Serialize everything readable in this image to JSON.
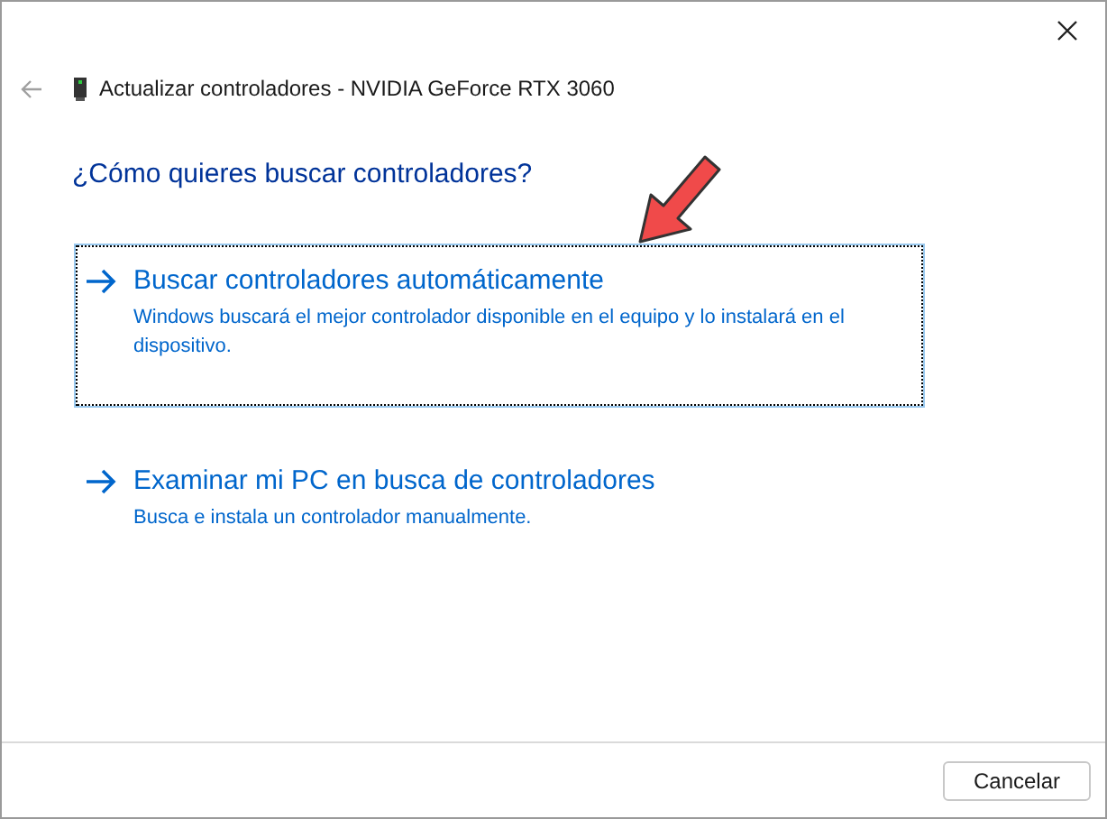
{
  "window": {
    "title": "Actualizar controladores - NVIDIA GeForce RTX 3060"
  },
  "heading": "¿Cómo quieres buscar controladores?",
  "options": [
    {
      "title": "Buscar controladores automáticamente",
      "description": "Windows buscará el mejor controlador disponible en el equipo y lo instalará en el dispositivo.",
      "selected": true
    },
    {
      "title": "Examinar mi PC en busca de controladores",
      "description": "Busca e instala un controlador manualmente.",
      "selected": false
    }
  ],
  "buttons": [
    "Cancelar"
  ]
}
